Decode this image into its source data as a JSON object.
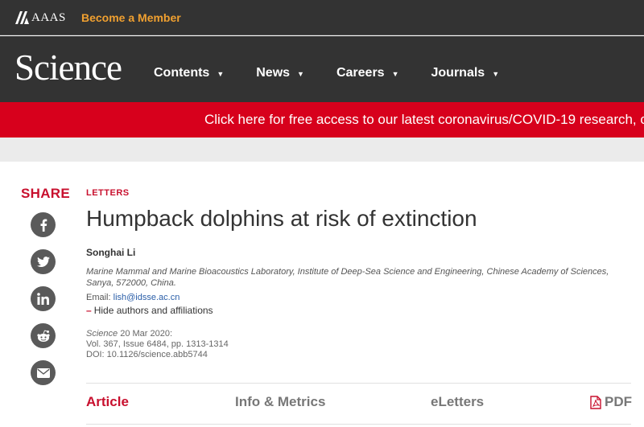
{
  "topbar": {
    "aaas_logo_text": "AAAS",
    "member_link": "Become a Member"
  },
  "header": {
    "logo_text": "Science",
    "nav": [
      {
        "label": "Contents"
      },
      {
        "label": "News"
      },
      {
        "label": "Careers"
      },
      {
        "label": "Journals"
      }
    ]
  },
  "banner": {
    "text": "Click here for free access to our latest coronavirus/COVID-19 research, commentary, and news."
  },
  "share": {
    "label": "SHARE",
    "buttons": [
      "facebook-icon",
      "twitter-icon",
      "linkedin-icon",
      "reddit-icon",
      "email-icon"
    ]
  },
  "article": {
    "section": "LETTERS",
    "title": "Humpback dolphins at risk of extinction",
    "author": "Songhai Li",
    "affiliation": "Marine Mammal and Marine Bioacoustics Laboratory, Institute of Deep-Sea Science and Engineering, Chinese Academy of Sciences, Sanya, 572000, China.",
    "email_label": "Email: ",
    "email": "lish@idsse.ac.cn",
    "hide_authors_symbol": "–",
    "hide_authors": "Hide authors and affiliations",
    "citation": {
      "journal": "Science",
      "date": "20 Mar 2020:",
      "volume": "Vol. 367, Issue 6484, pp. 1313-1314",
      "doi": "DOI: 10.1126/science.abb5744"
    }
  },
  "tabs": [
    {
      "label": "Article",
      "active": true
    },
    {
      "label": "Info & Metrics",
      "active": false
    },
    {
      "label": "eLetters",
      "active": false
    },
    {
      "label": "PDF",
      "active": false
    }
  ],
  "colors": {
    "header_bg": "#333333",
    "brand_red": "#c8102e",
    "banner_red": "#d7001c",
    "member_orange": "#f0a030"
  }
}
